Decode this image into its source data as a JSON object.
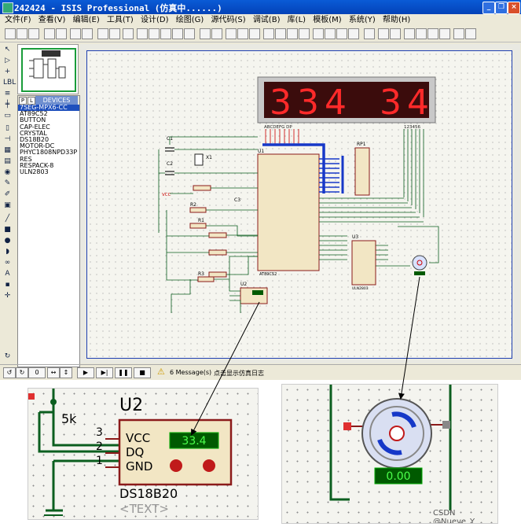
{
  "window": {
    "title": "242424 - ISIS Professional (仿真中......)"
  },
  "menu": [
    "文件(F)",
    "查看(V)",
    "编辑(E)",
    "工具(T)",
    "设计(D)",
    "绘图(G)",
    "源代码(S)",
    "调试(B)",
    "库(L)",
    "模板(M)",
    "系统(Y)",
    "帮助(H)"
  ],
  "devices": {
    "tab_p": "P",
    "tab_l": "L",
    "header": "DEVICES",
    "items": [
      "7SEG-MPX6-CC",
      "AT89C52",
      "BUTTON",
      "CAP-ELEC",
      "CRYSTAL",
      "DS18B20",
      "MOTOR-DC",
      "PHYC1808NPD33P",
      "RES",
      "RESPACK-8",
      "ULN2803"
    ],
    "selected_index": 0
  },
  "schematic": {
    "display_digits": [
      "3",
      "3",
      "4",
      "",
      "3",
      "4"
    ],
    "display_pins_left": "ABCDEFG DP",
    "display_pins_right": "123456",
    "u1_label": "U1",
    "u1_part": "AT89C52",
    "rp1": "RP1",
    "u3": "U3",
    "u3_part": "ULN2803",
    "u2": "U2",
    "x1": "X1",
    "c1": "C1",
    "c2": "C2",
    "c3": "C3",
    "r1": "R1",
    "r2": "R2",
    "r3": "R3",
    "vcc": "VCC"
  },
  "status": {
    "page_field": "0",
    "messages": "6 Message(s)",
    "hint": "点击显示仿真日志"
  },
  "zoom_left": {
    "ref": "U2",
    "res_label": "5k",
    "pin3": "3",
    "pin2": "2",
    "pin1": "1",
    "vcc": "VCC",
    "dq": "DQ",
    "gnd": "GND",
    "temp": "33.4",
    "part": "DS18B20",
    "text_tag": "<TEXT>"
  },
  "zoom_right": {
    "motor_readout": "0.00",
    "watermark": "CSDN @Nueve_Y"
  },
  "colors": {
    "titlebar": "#0a4fcf",
    "wire": "#0b5e1f",
    "component": "#8b1a1a",
    "component_fill": "#f2e6c4",
    "display_bg": "#3b0c0c",
    "display_led": "#ff2a2a",
    "bus": "#1638c8",
    "readout_bg": "#005a00",
    "readout_fg": "#4cff4c"
  }
}
